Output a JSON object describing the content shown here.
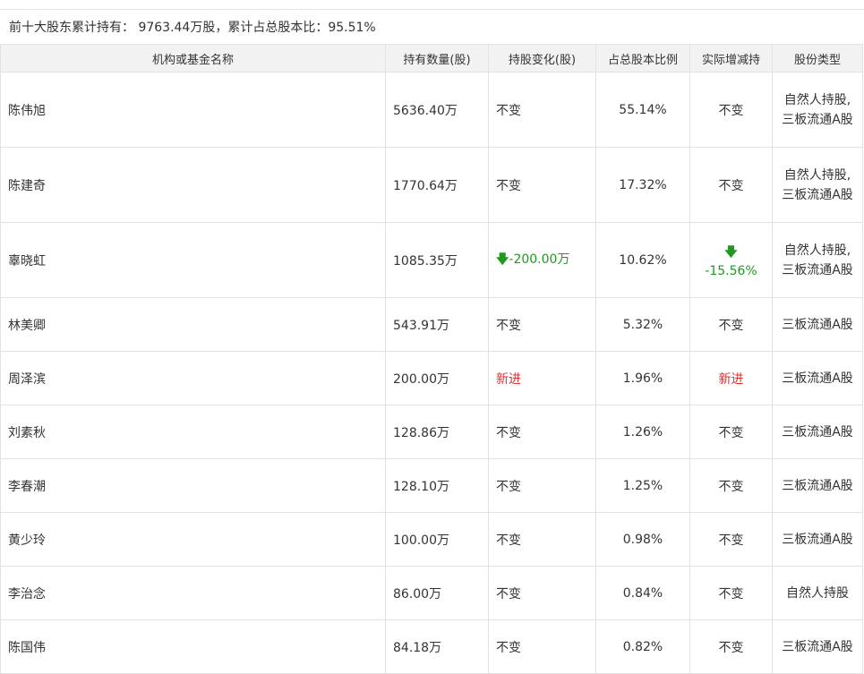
{
  "summary": "前十大股东累计持有： 9763.44万股，累计占总股本比：95.51%",
  "headers": [
    "机构或基金名称",
    "持有数量(股)",
    "持股变化(股)",
    "占总股本比例",
    "实际增减持",
    "股份类型"
  ],
  "rows": [
    {
      "name": "陈伟旭",
      "qty": "5636.40万",
      "change": "不变",
      "ratio": "55.14%",
      "actual": "不变",
      "type": "自然人持股,三板流通A股"
    },
    {
      "name": "陈建奇",
      "qty": "1770.64万",
      "change": "不变",
      "ratio": "17.32%",
      "actual": "不变",
      "type": "自然人持股,三板流通A股"
    },
    {
      "name": "辜晓虹",
      "qty": "1085.35万",
      "change": "-200.00万",
      "ratio": "10.62%",
      "actual": "-15.56%",
      "type": "自然人持股,三板流通A股"
    },
    {
      "name": "林美卿",
      "qty": "543.91万",
      "change": "不变",
      "ratio": "5.32%",
      "actual": "不变",
      "type": "三板流通A股"
    },
    {
      "name": "周泽滨",
      "qty": "200.00万",
      "change": "新进",
      "ratio": "1.96%",
      "actual": "新进",
      "type": "三板流通A股"
    },
    {
      "name": "刘素秋",
      "qty": "128.86万",
      "change": "不变",
      "ratio": "1.26%",
      "actual": "不变",
      "type": "三板流通A股"
    },
    {
      "name": "李春潮",
      "qty": "128.10万",
      "change": "不变",
      "ratio": "1.25%",
      "actual": "不变",
      "type": "三板流通A股"
    },
    {
      "name": "黄少玲",
      "qty": "100.00万",
      "change": "不变",
      "ratio": "0.98%",
      "actual": "不变",
      "type": "三板流通A股"
    },
    {
      "name": "李治念",
      "qty": "86.00万",
      "change": "不变",
      "ratio": "0.84%",
      "actual": "不变",
      "type": "自然人持股"
    },
    {
      "name": "陈国伟",
      "qty": "84.18万",
      "change": "不变",
      "ratio": "0.82%",
      "actual": "不变",
      "type": "三板流通A股"
    }
  ],
  "colors": {
    "decrease": "#1f9a1f",
    "new": "#e03030"
  },
  "icons": {
    "decrease": "down-arrow-icon"
  }
}
